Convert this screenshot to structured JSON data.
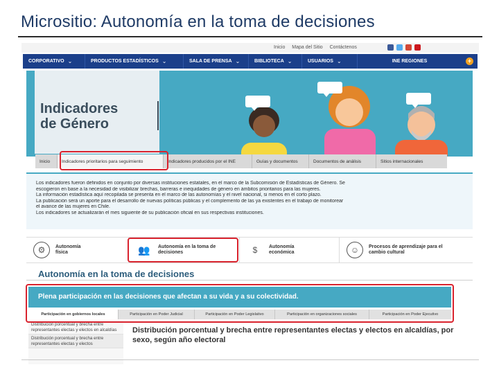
{
  "slide": {
    "title": "Micrositio: Autonomía en la toma de decisiones"
  },
  "topbar": {
    "links": [
      "Inicio",
      "Mapa del Sitio",
      "Contáctenos"
    ],
    "social_colors": [
      "#3b5998",
      "#55acee",
      "#d34836",
      "#cc181e"
    ]
  },
  "nav": {
    "items": [
      {
        "label": "CORPORATIVO",
        "chevron": "⌄"
      },
      {
        "label": "PRODUCTOS ESTADÍSTICOS",
        "chevron": "⌄"
      },
      {
        "label": "SALA DE PRENSA",
        "chevron": "⌄"
      },
      {
        "label": "BIBLIOTECA",
        "chevron": "⌄"
      },
      {
        "label": "USUARIOS",
        "chevron": "⌄"
      },
      {
        "label": "INE REGIONES",
        "chevron": ""
      }
    ],
    "plus": "+"
  },
  "hero": {
    "title_line1": "Indicadores",
    "title_line2": "de Género"
  },
  "subnav": {
    "items": [
      {
        "label": "Inicio"
      },
      {
        "label": "Indicadores prioritarios para seguimiento"
      },
      {
        "label": "Indicadores producidos por el INE"
      },
      {
        "label": "Guías y documentos"
      },
      {
        "label": "Documentos de análisis"
      },
      {
        "label": "Sitios internacionales"
      }
    ]
  },
  "intro": {
    "lines": [
      "Los indicadores fueron definidos en conjunto por diversas instituciones estatales, en el marco de la Subcomisión de Estadísticas de Género. Se",
      "escogieron en base a la necesidad de visibilizar brechas, barreras e inequidades de género en ámbitos prioritarios para las mujeres.",
      "La información estadística aquí recopilada se presenta en el marco de las autonomías y el nivel nacional, si menos en el corto plazo.",
      "La publicación será un aporte para el desarrollo de nuevas políticas públicas y el complemento de las ya existentes en el trabajo de monitorear",
      "el avance de las mujeres en Chile.",
      "Los indicadores se actualizarán el mes siguiente de su publicación oficial en sus respectivas instituciones."
    ]
  },
  "categories": [
    {
      "line1": "Autonomía",
      "line2": "física",
      "icon": "⚙"
    },
    {
      "line1": "Autonomía en la toma de",
      "line2": "decisiones",
      "icon": "👥"
    },
    {
      "line1": "Autonomía",
      "line2": "económica",
      "icon": "$"
    },
    {
      "line1": "Procesos de aprendizaje para el",
      "line2": "cambio cultural",
      "icon": "☺"
    }
  ],
  "section": {
    "title": "Autonomía en la toma de decisiones",
    "banner": "Plena participación en las decisiones que afectan a su vida y a su colectividad."
  },
  "tabs": [
    {
      "label": "Participación en gobiernos locales"
    },
    {
      "label": "Participación en Poder Judicial"
    },
    {
      "label": "Participación en Poder Legislativo"
    },
    {
      "label": "Participación en organizaciones sociales"
    },
    {
      "label": "Participación en Poder Ejecutivo"
    }
  ],
  "sidelist": [
    "Distribución porcentual y brecha entre representantes electas y electos en alcaldías",
    "Distribución porcentual y brecha entre representantes electas y electos"
  ],
  "main_heading": "Distribución porcentual y brecha entre representantes electas y electos en alcaldías, por sexo, según año electoral",
  "colors": {
    "nav": "#1b3f8a",
    "accent": "#46a9c3",
    "highlight": "#d9232e"
  }
}
